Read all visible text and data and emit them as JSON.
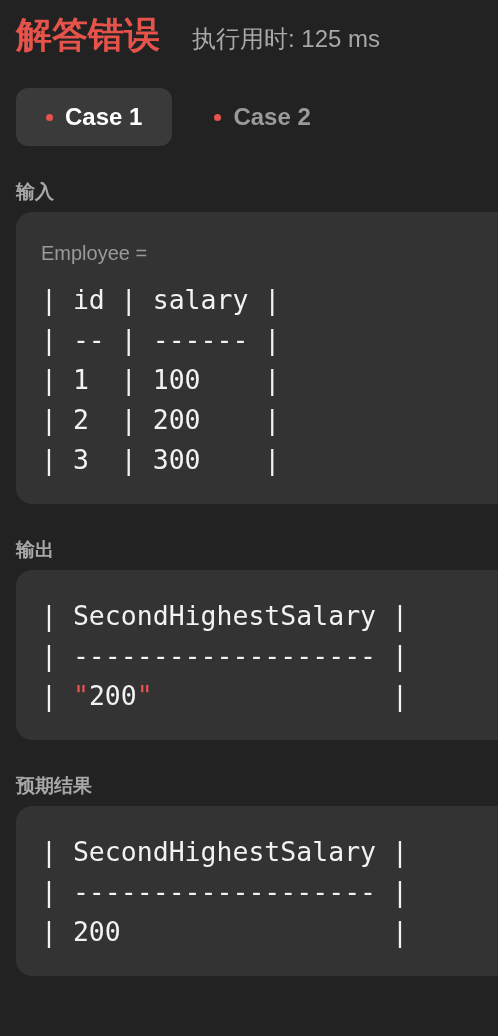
{
  "header": {
    "status": "解答错误",
    "runtime": "执行用时: 125 ms"
  },
  "cases": [
    {
      "label": "Case 1",
      "selected": true,
      "color": "#e5534b"
    },
    {
      "label": "Case 2",
      "selected": false,
      "color": "#e5534b"
    }
  ],
  "sections": [
    {
      "label": "输入",
      "caption": "Employee =",
      "lines": [
        [
          {
            "text": "| id | salary |",
            "kind": "plain"
          }
        ],
        [
          {
            "text": "| -- | ------ |",
            "kind": "plain"
          }
        ],
        [
          {
            "text": "| 1  | 100    |",
            "kind": "plain"
          }
        ],
        [
          {
            "text": "| 2  | 200    |",
            "kind": "plain"
          }
        ],
        [
          {
            "text": "| 3  | 300    |",
            "kind": "plain"
          }
        ]
      ]
    },
    {
      "label": "输出",
      "lines": [
        [
          {
            "text": "| SecondHighestSalary |",
            "kind": "plain"
          }
        ],
        [
          {
            "text": "| ------------------- |",
            "kind": "plain"
          }
        ],
        [
          {
            "text": "| ",
            "kind": "plain"
          },
          {
            "text": "\"",
            "kind": "quote"
          },
          {
            "text": "200",
            "kind": "plain"
          },
          {
            "text": "\"",
            "kind": "quote"
          },
          {
            "text": "               |",
            "kind": "plain"
          }
        ]
      ]
    },
    {
      "label": "预期结果",
      "lines": [
        [
          {
            "text": "| SecondHighestSalary |",
            "kind": "plain"
          }
        ],
        [
          {
            "text": "| ------------------- |",
            "kind": "plain"
          }
        ],
        [
          {
            "text": "| 200                 |",
            "kind": "plain"
          }
        ]
      ]
    }
  ]
}
